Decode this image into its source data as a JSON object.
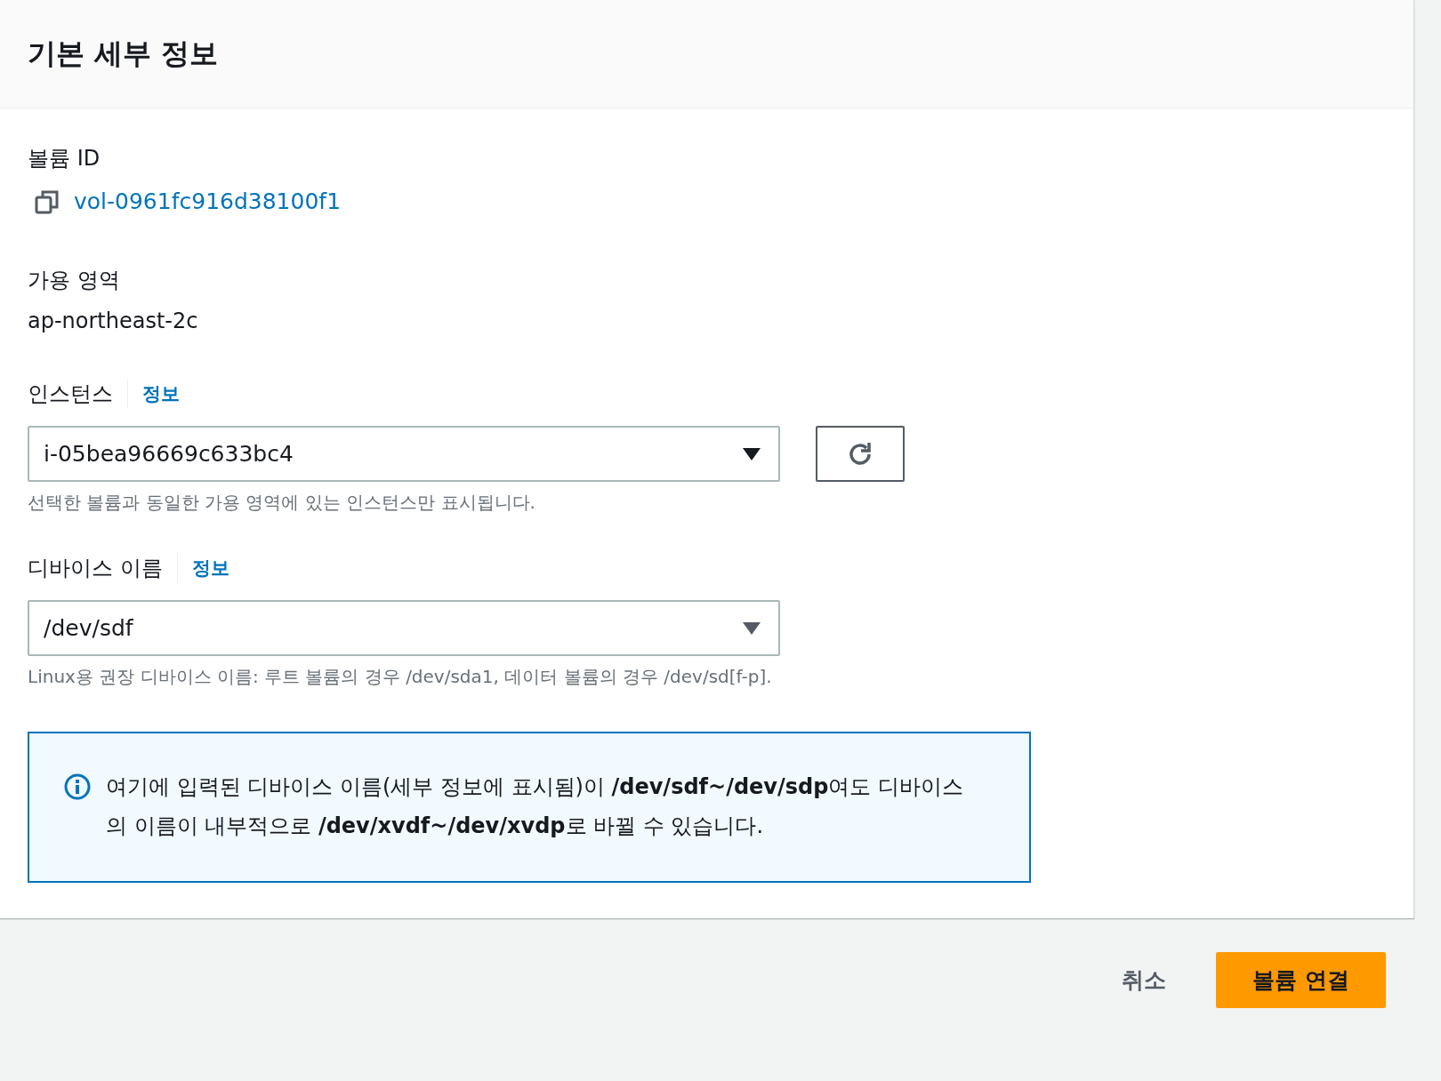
{
  "header": {
    "title": "기본 세부 정보"
  },
  "volume_id": {
    "label": "볼륨 ID",
    "value": "vol-0961fc916d38100f1"
  },
  "availability_zone": {
    "label": "가용 영역",
    "value": "ap-northeast-2c"
  },
  "instance": {
    "label": "인스턴스",
    "info": "정보",
    "value": "i-05bea96669c633bc4",
    "hint": "선택한 볼륨과 동일한 가용 영역에 있는 인스턴스만 표시됩니다."
  },
  "device_name": {
    "label": "디바이스 이름",
    "info": "정보",
    "value": "/dev/sdf",
    "hint": "Linux용 권장 디바이스 이름: 루트 볼륨의 경우 /dev/sda1, 데이터 볼륨의 경우 /dev/sd[f-p]."
  },
  "info_alert": {
    "text": "여기에 입력된 디바이스 이름(세부 정보에 표시됨)이 **/dev/sdf~/dev/sdp**여도 디바이스의 이름이 내부적으로 **/dev/xvdf~/dev/xvdp**로 바뀔 수 있습니다."
  },
  "actions": {
    "cancel": "취소",
    "submit": "볼륨 연결"
  }
}
